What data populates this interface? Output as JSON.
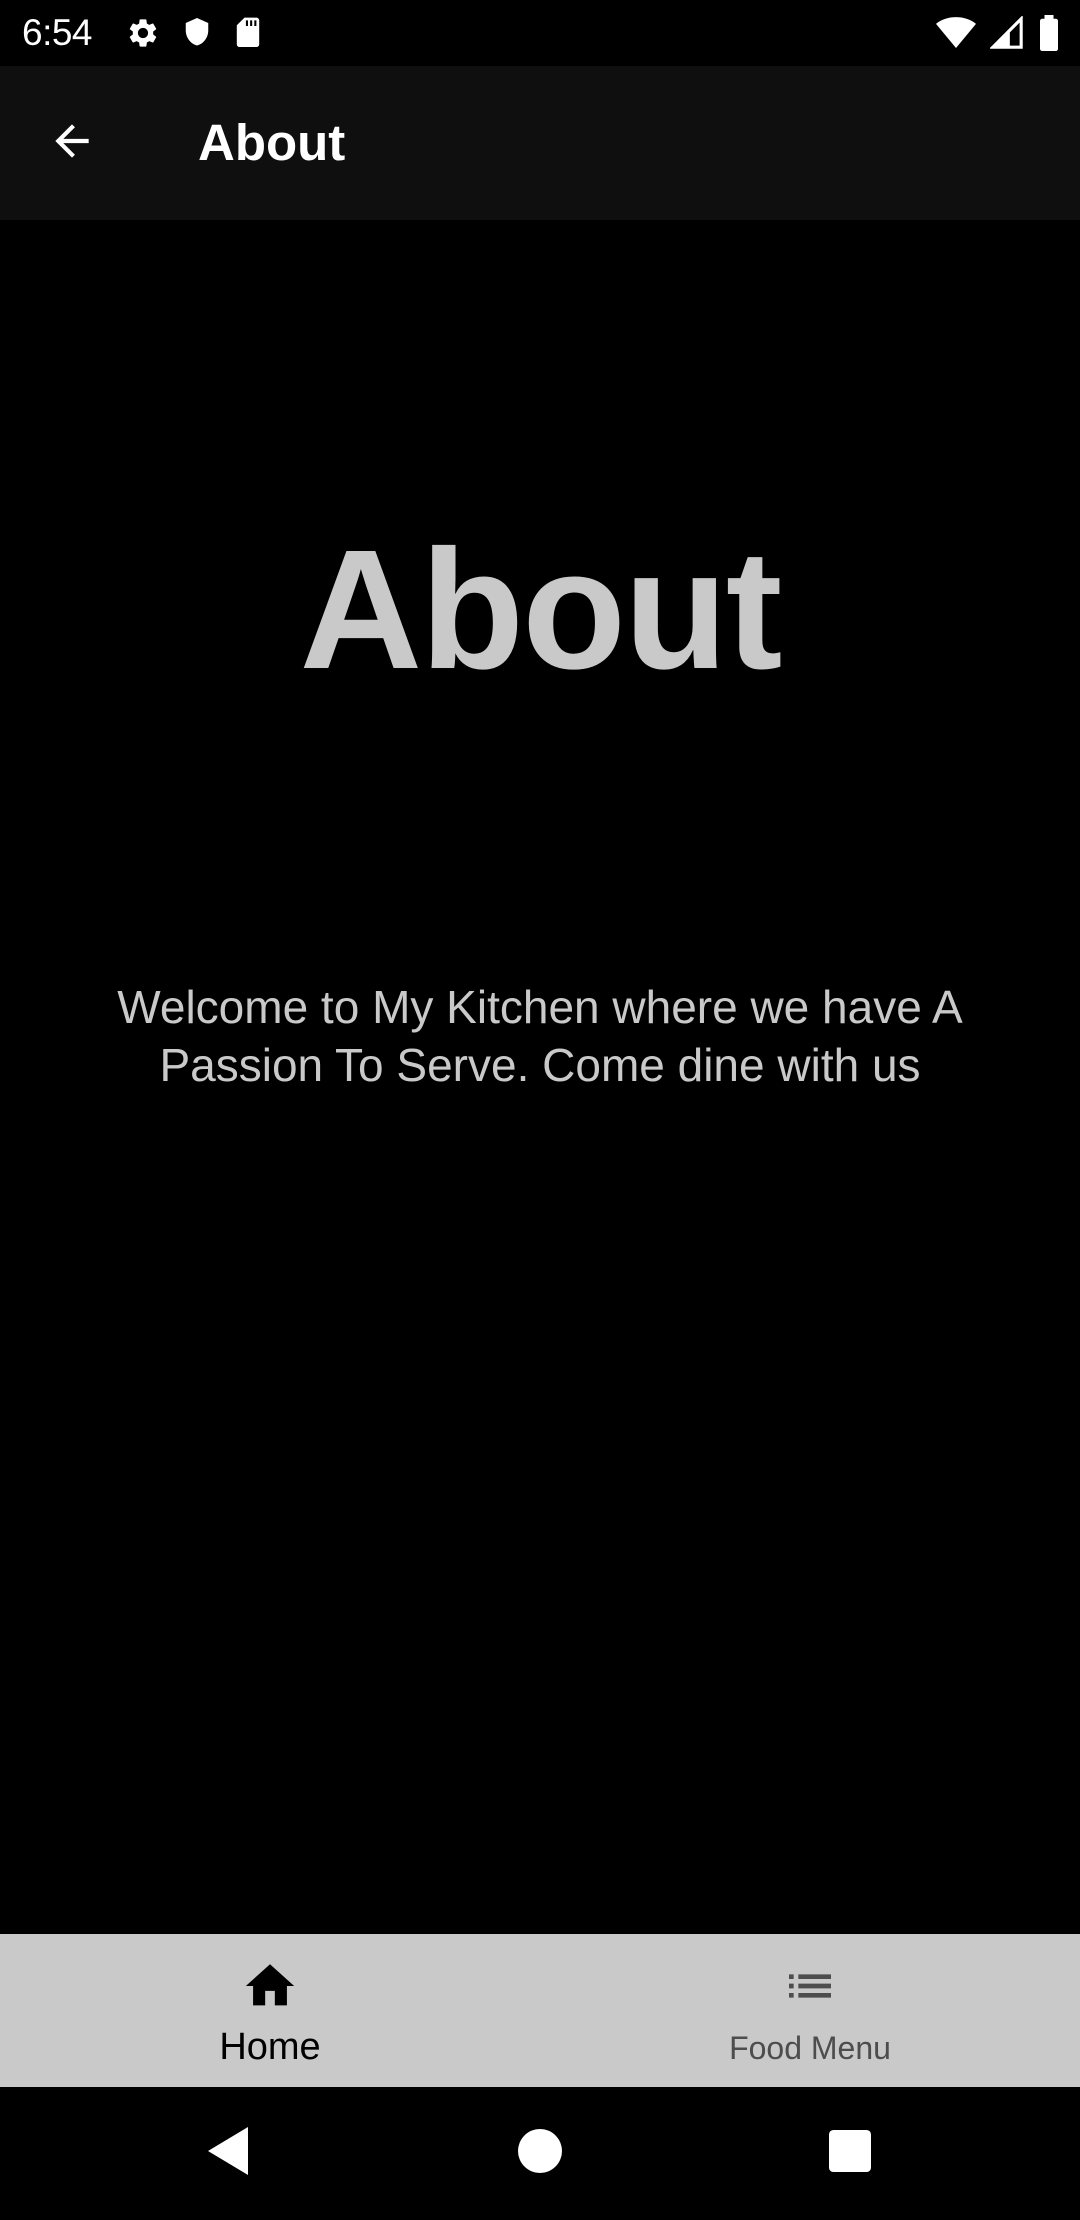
{
  "status_bar": {
    "time": "6:54",
    "left_icons": [
      "gear-icon",
      "shield-icon",
      "sd-card-icon"
    ],
    "right_icons": [
      "wifi-icon",
      "cell-signal-icon",
      "battery-icon"
    ]
  },
  "app_bar": {
    "title": "About",
    "back_icon": "arrow-left-icon"
  },
  "main": {
    "heading": "About",
    "welcome_text": "Welcome to My Kitchen where we have A Passion To Serve. Come dine with us"
  },
  "bottom_nav": {
    "items": [
      {
        "label": "Home",
        "icon": "home-icon",
        "active": true
      },
      {
        "label": "Food Menu",
        "icon": "list-icon",
        "active": false
      }
    ]
  },
  "system_nav": {
    "buttons": [
      "back-triangle-icon",
      "home-circle-icon",
      "recents-square-icon"
    ]
  },
  "colors": {
    "background": "#000000",
    "app_bar": "#0f0f0f",
    "text_primary": "#ffffff",
    "text_muted": "#c9c9c9",
    "bottom_nav_bg": "#c9c9c9",
    "nav_active": "#000000",
    "nav_inactive": "#4d4d4d"
  }
}
